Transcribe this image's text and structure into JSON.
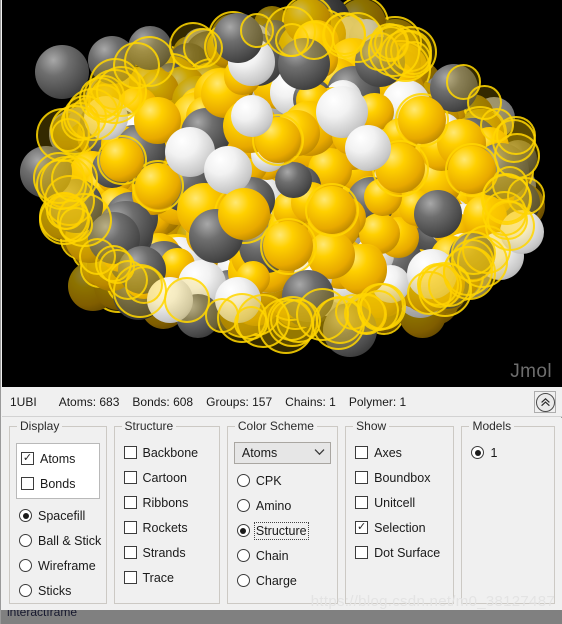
{
  "viewport": {
    "background_color": "#000000",
    "logo": "Jmol",
    "representation": "spacefill",
    "atom_colors": {
      "gold": "#FFD000",
      "gray": "#4A4A4A",
      "white": "#F2F2F2",
      "magenta": "#9C0F78",
      "orange": "#F08A10",
      "halo": "#FFD600"
    }
  },
  "infobar": {
    "pdb_id": "1UBI",
    "stats": [
      "Atoms: 683",
      "Bonds: 608",
      "Groups: 157",
      "Chains: 1",
      "Polymer: 1"
    ],
    "collapse_icon": "chevron-double-up-icon",
    "collapse_glyph": "«"
  },
  "controls": {
    "display": {
      "legend": "Display",
      "checkboxes": [
        {
          "label": "Atoms",
          "checked": true
        },
        {
          "label": "Bonds",
          "checked": false
        }
      ],
      "radios": [
        {
          "label": "Spacefill",
          "selected": true
        },
        {
          "label": "Ball & Stick",
          "selected": false
        },
        {
          "label": "Wireframe",
          "selected": false
        },
        {
          "label": "Sticks",
          "selected": false
        }
      ]
    },
    "structure": {
      "legend": "Structure",
      "checkboxes": [
        {
          "label": "Backbone",
          "checked": false
        },
        {
          "label": "Cartoon",
          "checked": false
        },
        {
          "label": "Ribbons",
          "checked": false
        },
        {
          "label": "Rockets",
          "checked": false
        },
        {
          "label": "Strands",
          "checked": false
        },
        {
          "label": "Trace",
          "checked": false
        }
      ]
    },
    "color_scheme": {
      "legend": "Color Scheme",
      "select_value": "Atoms",
      "select_icon": "chevron-down-icon",
      "radios": [
        {
          "label": "CPK",
          "selected": false,
          "focused": false
        },
        {
          "label": "Amino",
          "selected": false,
          "focused": false
        },
        {
          "label": "Structure",
          "selected": true,
          "focused": true
        },
        {
          "label": "Chain",
          "selected": false,
          "focused": false
        },
        {
          "label": "Charge",
          "selected": false,
          "focused": false
        }
      ]
    },
    "show": {
      "legend": "Show",
      "checkboxes": [
        {
          "label": "Axes",
          "checked": false
        },
        {
          "label": "Boundbox",
          "checked": false
        },
        {
          "label": "Unitcell",
          "checked": false
        },
        {
          "label": "Selection",
          "checked": true
        },
        {
          "label": "Dot Surface",
          "checked": false
        }
      ]
    },
    "models": {
      "legend": "Models",
      "radios": [
        {
          "label": "1",
          "selected": true
        }
      ]
    }
  },
  "watermark": "https://blog.csdn.net/m0_38127487",
  "bottom_cut_text": "interactframe",
  "check_glyph": "✓"
}
